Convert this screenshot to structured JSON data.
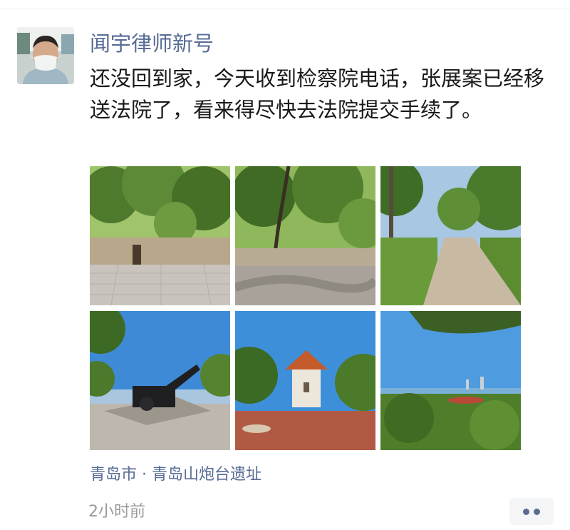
{
  "post": {
    "author_name": "闻宇律师新号",
    "text": "还没回到家，今天收到检察院电话，张展案已经移送法院了，看来得尽快去法院提交手续了。",
    "location": "青岛市 · 青岛山炮台遗址",
    "timestamp": "2小时前",
    "photo_count": 6
  },
  "icons": {
    "avatar": "avatar-man-with-face-mask",
    "more": "more-dots-icon"
  },
  "colors": {
    "link": "#576b95",
    "text": "#191919",
    "muted": "#9a9a9a",
    "more_bg": "#f4f5f7"
  }
}
